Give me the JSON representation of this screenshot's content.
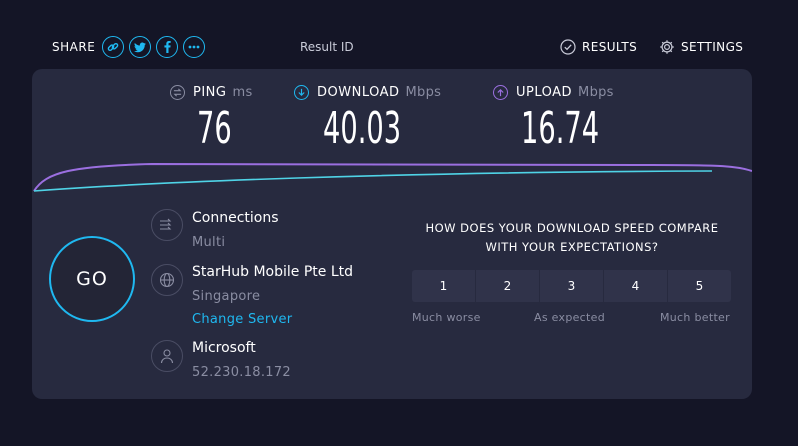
{
  "header": {
    "share_label": "SHARE",
    "share_buttons": [
      {
        "icon": "link-icon"
      },
      {
        "icon": "twitter-icon"
      },
      {
        "icon": "facebook-icon"
      },
      {
        "icon": "more-icon"
      }
    ],
    "result_id_label": "Result ID",
    "results_label": "RESULTS",
    "settings_label": "SETTINGS"
  },
  "metrics": {
    "ping": {
      "label": "PING",
      "unit": "ms",
      "value": "76"
    },
    "download": {
      "label": "DOWNLOAD",
      "unit": "Mbps",
      "value": "40.03"
    },
    "upload": {
      "label": "UPLOAD",
      "unit": "Mbps",
      "value": "16.74"
    }
  },
  "go_label": "GO",
  "connections": {
    "title": "Connections",
    "mode": "Multi"
  },
  "isp": {
    "name": "StarHub Mobile Pte Ltd",
    "location": "Singapore",
    "change_server": "Change Server"
  },
  "host": {
    "name": "Microsoft",
    "ip": "52.230.18.172"
  },
  "survey": {
    "question_line1": "HOW DOES YOUR DOWNLOAD SPEED COMPARE",
    "question_line2": "WITH YOUR EXPECTATIONS?",
    "options": [
      "1",
      "2",
      "3",
      "4",
      "5"
    ],
    "label_low": "Much worse",
    "label_mid": "As expected",
    "label_high": "Much better"
  },
  "colors": {
    "background": "#141526",
    "panel": "#272a3f",
    "accent_cyan": "#1fb8f0",
    "accent_purple": "#9b6fe0",
    "muted_text": "#8a8da2"
  }
}
